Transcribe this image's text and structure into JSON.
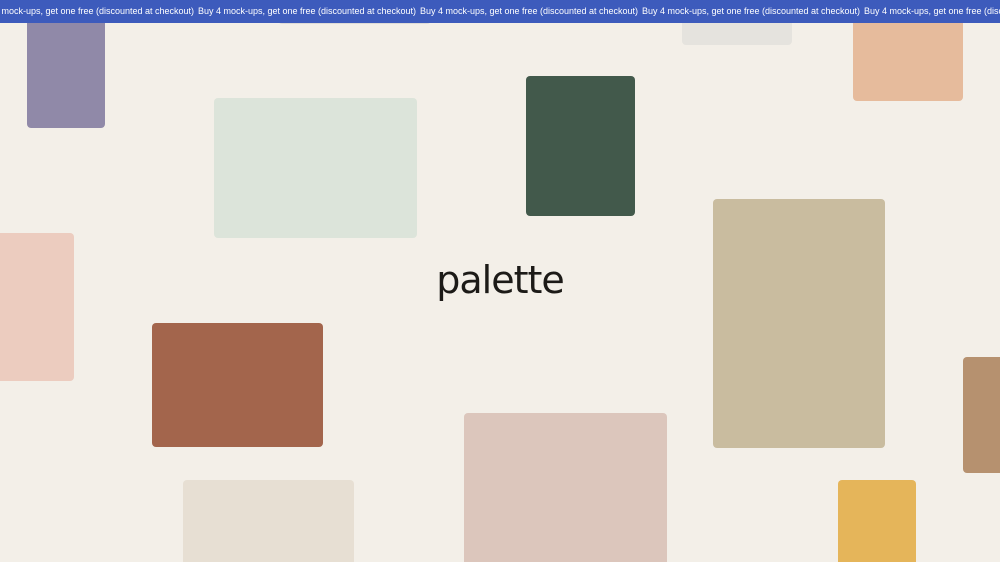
{
  "promo_bar": {
    "background": "#3d5bbc",
    "text_color": "#ffffff",
    "items": [
      "Buy 4 mock-ups, get one free (discounted at checkout)",
      "Buy 4 mock-ups, get one free (discounted at checkout)",
      "Buy 4 mock-ups, get one free (discounted at checkout)",
      "Buy 4 mock-ups, get one free (discounted at checkout)",
      "Buy 4 mock-ups, get one free (discounted at checkout)"
    ]
  },
  "hero": {
    "background": "#f3efe8",
    "logo_text": "palette",
    "logo_color": "#1c1a17"
  },
  "swatches": [
    {
      "name": "lavender",
      "color": "#9089a8"
    },
    {
      "name": "pale-gray-top",
      "color": "#dedbd6"
    },
    {
      "name": "light-gray",
      "color": "#e5e3de"
    },
    {
      "name": "peach",
      "color": "#e6bb9c"
    },
    {
      "name": "sage-mist",
      "color": "#dce4da"
    },
    {
      "name": "forest-green",
      "color": "#42594b"
    },
    {
      "name": "sand",
      "color": "#c9bc9f"
    },
    {
      "name": "blush",
      "color": "#ecccbf"
    },
    {
      "name": "terracotta",
      "color": "#a3654c"
    },
    {
      "name": "rose-dust",
      "color": "#dcc6bc"
    },
    {
      "name": "clay",
      "color": "#b6916f"
    },
    {
      "name": "linen",
      "color": "#e7dfd3"
    },
    {
      "name": "mustard",
      "color": "#e5b55a"
    }
  ]
}
